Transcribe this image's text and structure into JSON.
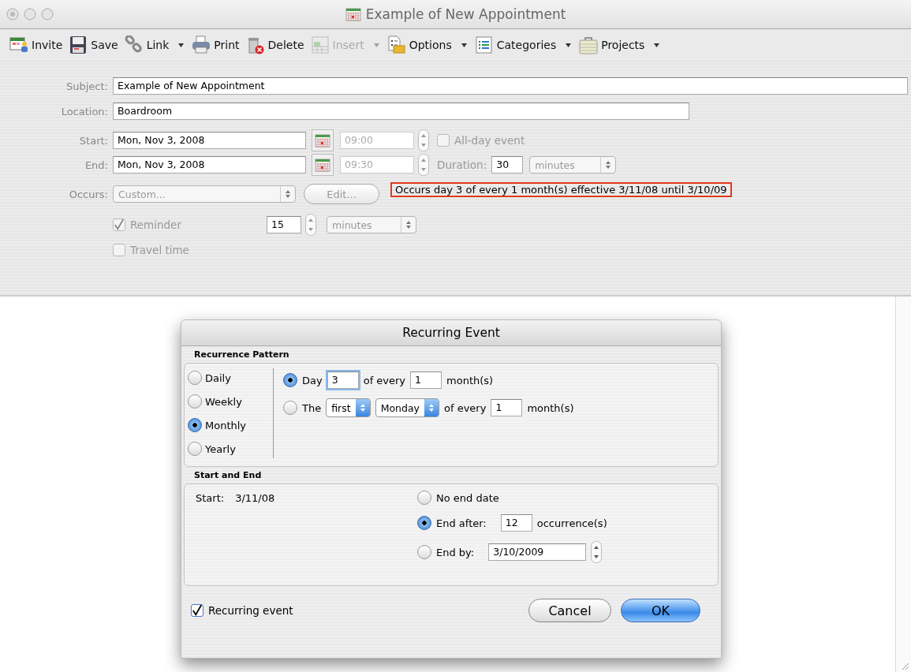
{
  "window": {
    "title": "Example of New Appointment"
  },
  "toolbar": [
    {
      "label": "Invite",
      "dropdown": false,
      "disabled": false
    },
    {
      "label": "Save",
      "dropdown": false,
      "disabled": false
    },
    {
      "label": "Link",
      "dropdown": true,
      "disabled": false
    },
    {
      "label": "Print",
      "dropdown": false,
      "disabled": false
    },
    {
      "label": "Delete",
      "dropdown": false,
      "disabled": false
    },
    {
      "label": "Insert",
      "dropdown": true,
      "disabled": true
    },
    {
      "label": "Options",
      "dropdown": true,
      "disabled": false
    },
    {
      "label": "Categories",
      "dropdown": true,
      "disabled": false
    },
    {
      "label": "Projects",
      "dropdown": true,
      "disabled": false
    }
  ],
  "form": {
    "subject": {
      "label": "Subject:",
      "value": "Example of New Appointment"
    },
    "location": {
      "label": "Location:",
      "value": "Boardroom"
    },
    "start": {
      "label": "Start:",
      "date": "Mon, Nov 3, 2008",
      "time": "09:00",
      "time_disabled": true
    },
    "end": {
      "label": "End:",
      "date": "Mon, Nov 3, 2008",
      "time": "09:30",
      "time_disabled": true
    },
    "all_day": {
      "label": "All-day event",
      "checked": false,
      "disabled": true
    },
    "duration": {
      "label": "Duration:",
      "value": "30",
      "unit": "minutes",
      "disabled": true
    },
    "occurs": {
      "label": "Occurs:",
      "value": "Custom...",
      "disabled": true
    },
    "edit_button": {
      "label": "Edit...",
      "disabled": true
    },
    "summary": "Occurs day 3 of every 1 month(s) effective 3/11/08 until 3/10/09",
    "reminder": {
      "label": "Reminder",
      "checked": true,
      "disabled": true,
      "value": "15",
      "unit": "minutes"
    },
    "travel_time": {
      "label": "Travel time",
      "checked": false,
      "disabled": true
    }
  },
  "dialog": {
    "title": "Recurring Event",
    "pattern": {
      "heading": "Recurrence Pattern",
      "frequencies": [
        {
          "label": "Daily",
          "selected": false
        },
        {
          "label": "Weekly",
          "selected": false
        },
        {
          "label": "Monthly",
          "selected": true
        },
        {
          "label": "Yearly",
          "selected": false
        }
      ],
      "options": [
        {
          "selected": true,
          "parts": [
            {
              "kind": "text",
              "text": "Day"
            },
            {
              "kind": "field",
              "value": "3",
              "focused": true
            },
            {
              "kind": "text",
              "text": "of every"
            },
            {
              "kind": "field",
              "value": "1",
              "focused": false
            },
            {
              "kind": "text",
              "text": "month(s)"
            }
          ]
        },
        {
          "selected": false,
          "parts": [
            {
              "kind": "text",
              "text": "The"
            },
            {
              "kind": "select",
              "value": "first"
            },
            {
              "kind": "select",
              "value": "Monday"
            },
            {
              "kind": "text",
              "text": "of every"
            },
            {
              "kind": "field",
              "value": "1",
              "focused": false
            },
            {
              "kind": "text",
              "text": "month(s)"
            }
          ]
        }
      ]
    },
    "start_end": {
      "heading": "Start and End",
      "start_label": "Start:",
      "start_value": "3/11/08",
      "options": [
        {
          "selected": false,
          "parts": [
            {
              "kind": "text",
              "text": "No end date"
            }
          ]
        },
        {
          "selected": true,
          "parts": [
            {
              "kind": "text",
              "text": "End after:"
            },
            {
              "kind": "field",
              "value": "12",
              "focused": false
            },
            {
              "kind": "text",
              "text": "occurrence(s)"
            }
          ]
        },
        {
          "selected": false,
          "parts": [
            {
              "kind": "text",
              "text": "End by:"
            },
            {
              "kind": "date",
              "value": "3/10/2009"
            }
          ]
        }
      ]
    },
    "recurring_event": {
      "label": "Recurring event",
      "checked": true
    },
    "buttons": [
      {
        "label": "Cancel",
        "kind": "cancel"
      },
      {
        "label": "OK",
        "kind": "default"
      }
    ]
  }
}
